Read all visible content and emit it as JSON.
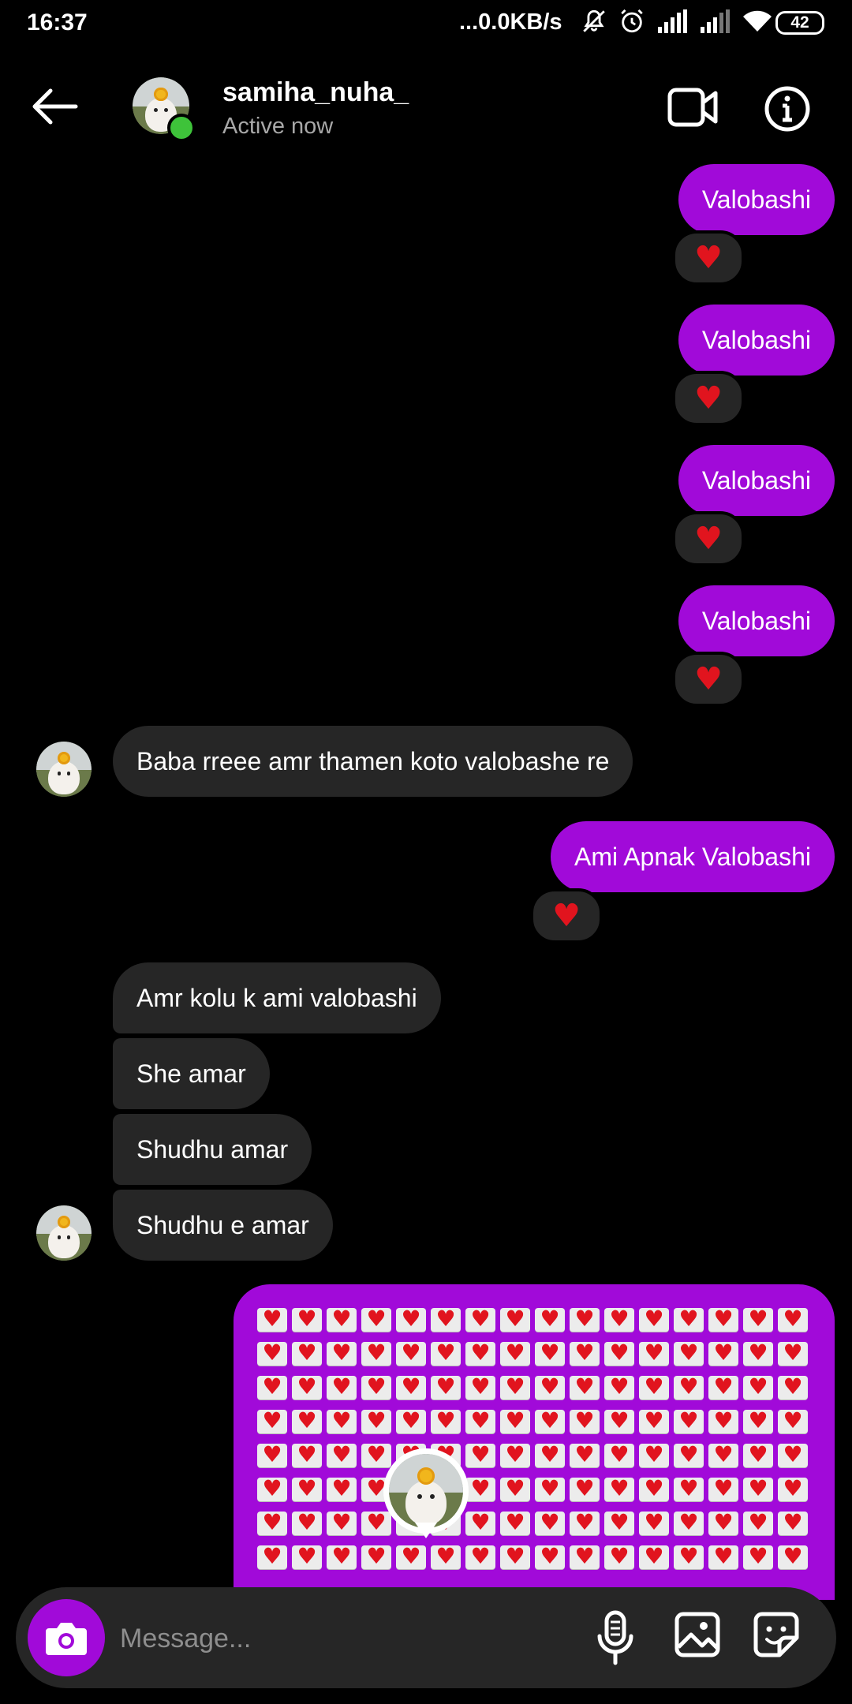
{
  "status_bar": {
    "time": "16:37",
    "network_speed": "...0.0KB/s",
    "battery": "42"
  },
  "header": {
    "username": "samiha_nuha_",
    "status": "Active now"
  },
  "messages": [
    {
      "text": "Valobashi",
      "reaction": "heart"
    },
    {
      "text": "Valobashi",
      "reaction": "heart"
    },
    {
      "text": "Valobashi",
      "reaction": "heart"
    },
    {
      "text": "Valobashi",
      "reaction": "heart"
    },
    {
      "text": "Baba rreee amr thamen koto valobashe re"
    },
    {
      "text": "Ami Apnak Valobashi",
      "reaction": "heart"
    },
    {
      "text": "Amr kolu k ami valobashi"
    },
    {
      "text": "She amar"
    },
    {
      "text": "Shudhu amar"
    },
    {
      "text": "Shudhu e amar"
    }
  ],
  "hearts_message": {
    "emoji": "love-letter",
    "columns": 16,
    "rows": 8
  },
  "composer": {
    "placeholder": "Message..."
  },
  "colors": {
    "outgoing_bubble": "#a10ad9",
    "incoming_bubble": "#262626",
    "online_dot": "#3ec33a"
  }
}
